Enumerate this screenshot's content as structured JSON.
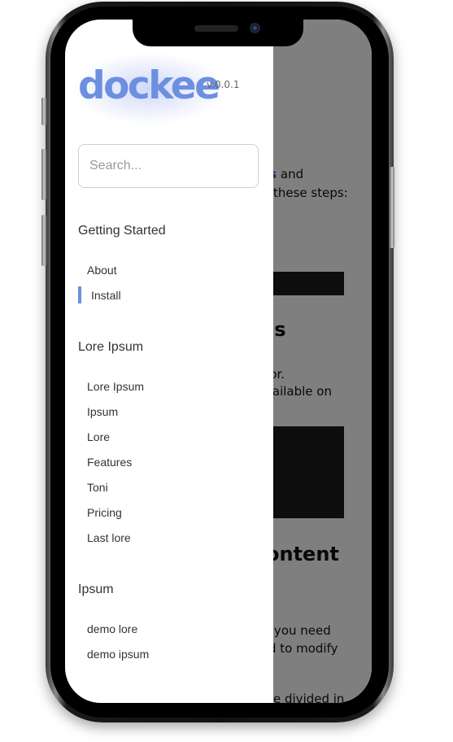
{
  "brand": {
    "name": "dockee",
    "version": "v.0.0.1"
  },
  "search": {
    "placeholder": "Search..."
  },
  "nav": [
    {
      "title": "Getting Started",
      "items": [
        "About",
        "Install"
      ],
      "active": "Install"
    },
    {
      "title": "Lore Ipsum",
      "items": [
        "Lore Ipsum",
        "Ipsum",
        "Lore",
        "Features",
        "Toni",
        "Pricing",
        "Last lore"
      ]
    },
    {
      "title": "Ipsum",
      "items": [
        "demo lore",
        "demo ipsum"
      ]
    }
  ],
  "content": {
    "line1_link": "es",
    "line1_text": " and",
    "line2": "these steps:",
    "heading1": "es",
    "line3": "olor.",
    "line4": "vailable on",
    "heading2": "ontent",
    "line5": "l you need",
    "line6": "d to modify",
    "line7": "e divided in"
  },
  "colors": {
    "accent": "#6d8fe0",
    "overlay": "rgba(0,0,0,0.5)"
  }
}
